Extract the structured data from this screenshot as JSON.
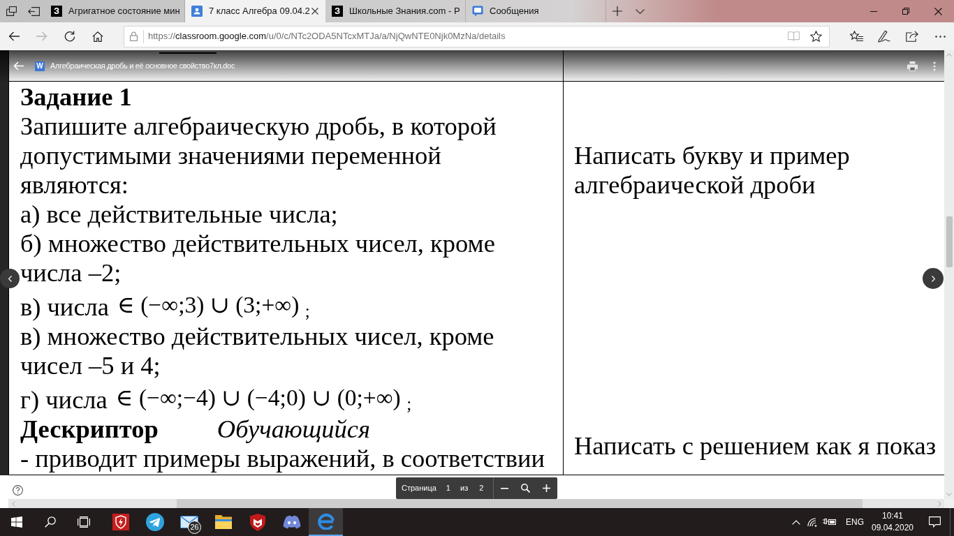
{
  "tabs": [
    {
      "kind": "letter",
      "logo": "З",
      "title": "Агригатное состояние мин",
      "selected": false
    },
    {
      "kind": "classroom",
      "title": "7 класс Алгебра 09.04.2",
      "selected": true
    },
    {
      "kind": "letter",
      "logo": "З",
      "title": "Школьные Знания.com - Р",
      "selected": false
    },
    {
      "kind": "chat",
      "title": "Сообщения",
      "selected": false
    }
  ],
  "nav_buttons": [
    {
      "kind": "back",
      "disabled": false
    },
    {
      "kind": "forward",
      "disabled": true
    },
    {
      "kind": "refresh",
      "disabled": false
    },
    {
      "kind": "home",
      "disabled": false
    }
  ],
  "address_bar": {
    "url": "https://classroom.google.com/u/0/c/NTc2ODA5NTcxMTJa/a/NjQwNTE0Njk0MzNa/details"
  },
  "viewer_header": {
    "file_badge": "W",
    "file_name": "Алгебраическая дробь и её основное свойство7кл.doc"
  },
  "document": {
    "task_cell": [
      {
        "kind": "heading",
        "text": "Задание 1"
      },
      {
        "kind": "paragraph",
        "text": "Запишите алгебраическую дробь, в которой\nдопустимыми значениями переменной\nявляются:"
      },
      {
        "kind": "paragraph",
        "text": "а) все действительные числа;"
      },
      {
        "kind": "paragraph",
        "text": "б) множество действительных чисел, кроме\nчисла –2;"
      },
      {
        "kind": "formula_line",
        "text": "в) числа",
        "formula": "∈ (−∞;3) ∪ (3;+∞) $_{;}$"
      },
      {
        "kind": "paragraph",
        "text": "в) множество действительных чисел, кроме\nчисел –5 и 4;"
      },
      {
        "kind": "formula_line",
        "text": "г) числа",
        "formula": "∈ (−∞;−4) ∪ (−4;0) ∪ (0;+∞) $_{;}$"
      },
      {
        "kind": "descriptor",
        "label": "Дескриптор",
        "subject": "Обучающийся"
      },
      {
        "kind": "paragraph",
        "text": "- приводит примеры выражений, в соответствии"
      }
    ],
    "note_cell": [
      "Написать букву и пример\nалгебраической дроби",
      "Написать с решением как я показ"
    ]
  },
  "page_toolbar": {
    "label": "Страница",
    "current": "1",
    "separator": "из",
    "total": "2"
  },
  "taskbar": {
    "buttons": [
      {
        "kind": "start"
      },
      {
        "kind": "search"
      },
      {
        "kind": "task_view"
      }
    ],
    "apps": [
      {
        "kind": "lightning",
        "active": false
      },
      {
        "kind": "telegram",
        "active": false
      },
      {
        "kind": "mail",
        "badge": "26",
        "active": false
      },
      {
        "kind": "folder",
        "active": false
      },
      {
        "kind": "shield",
        "active": false
      },
      {
        "kind": "discord",
        "active": false
      },
      {
        "kind": "edge",
        "active": true
      }
    ],
    "tray": {
      "language": "ENG",
      "time": "10:41",
      "date": "09.04.2020"
    }
  }
}
